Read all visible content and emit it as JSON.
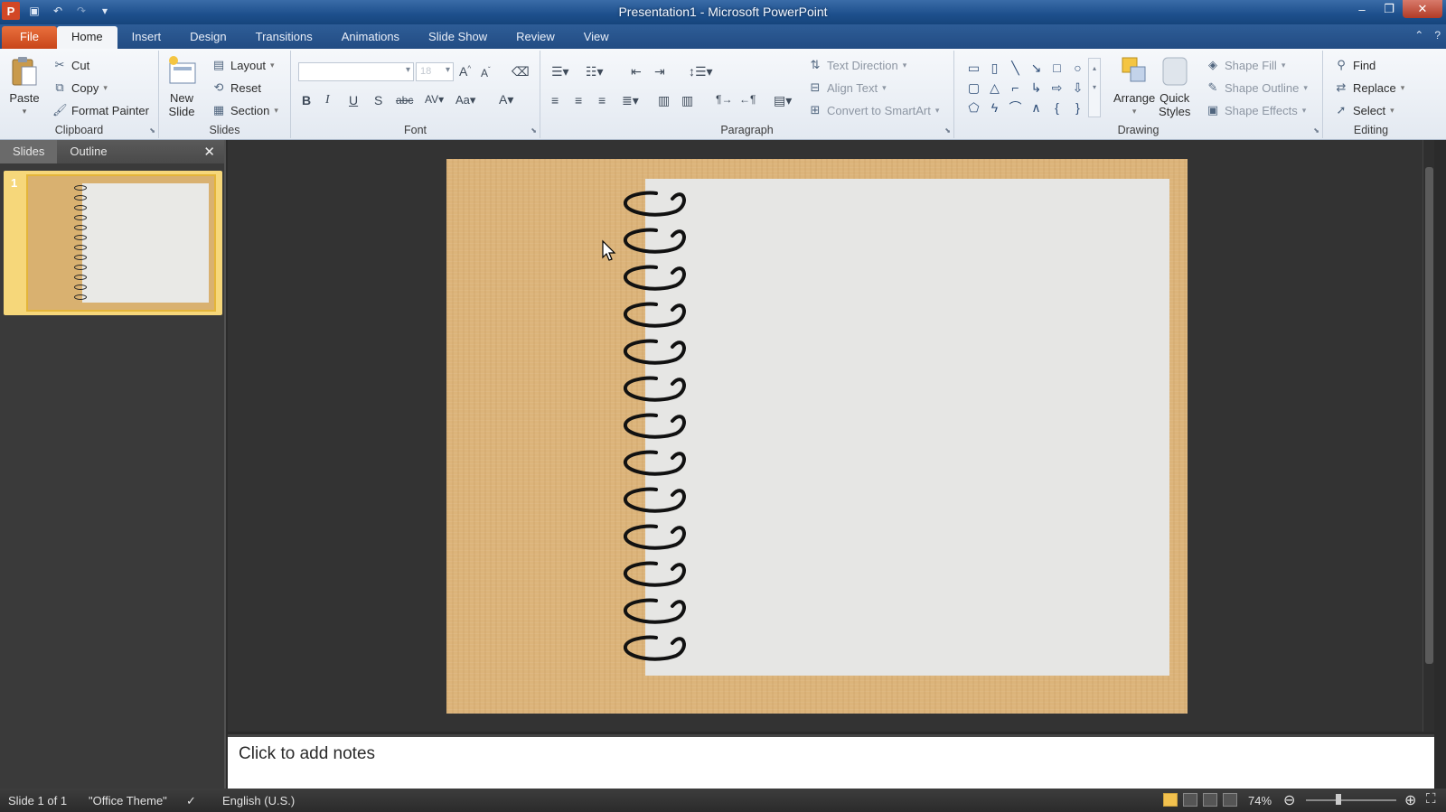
{
  "window": {
    "title": "Presentation1 - Microsoft PowerPoint",
    "app_logo": "P"
  },
  "tabs": [
    "File",
    "Home",
    "Insert",
    "Design",
    "Transitions",
    "Animations",
    "Slide Show",
    "Review",
    "View"
  ],
  "active_tab": "Home",
  "ribbon": {
    "clipboard": {
      "label": "Clipboard",
      "paste": "Paste",
      "cut": "Cut",
      "copy": "Copy",
      "format_painter": "Format Painter"
    },
    "slides": {
      "label": "Slides",
      "new_slide_1": "New",
      "new_slide_2": "Slide",
      "layout": "Layout",
      "reset": "Reset",
      "section": "Section"
    },
    "font": {
      "label": "Font",
      "size": "18"
    },
    "paragraph": {
      "label": "Paragraph",
      "text_direction": "Text Direction",
      "align_text": "Align Text",
      "convert_smartart": "Convert to SmartArt"
    },
    "drawing": {
      "label": "Drawing",
      "arrange": "Arrange",
      "quick_styles_1": "Quick",
      "quick_styles_2": "Styles",
      "shape_fill": "Shape Fill",
      "shape_outline": "Shape Outline",
      "shape_effects": "Shape Effects"
    },
    "editing": {
      "label": "Editing",
      "find": "Find",
      "replace": "Replace",
      "select": "Select"
    }
  },
  "panel": {
    "tabs": [
      "Slides",
      "Outline"
    ],
    "slide_number": "1"
  },
  "notes": {
    "placeholder": "Click to add notes"
  },
  "status": {
    "slide_info": "Slide 1 of 1",
    "theme": "\"Office Theme\"",
    "language": "English (U.S.)",
    "zoom": "74%"
  },
  "colors": {
    "file_tab": "#d55a27",
    "ribbon_bg": "#eef2f7",
    "slide_wood": "#dcb47a",
    "page_paper": "#e6e6e4"
  }
}
